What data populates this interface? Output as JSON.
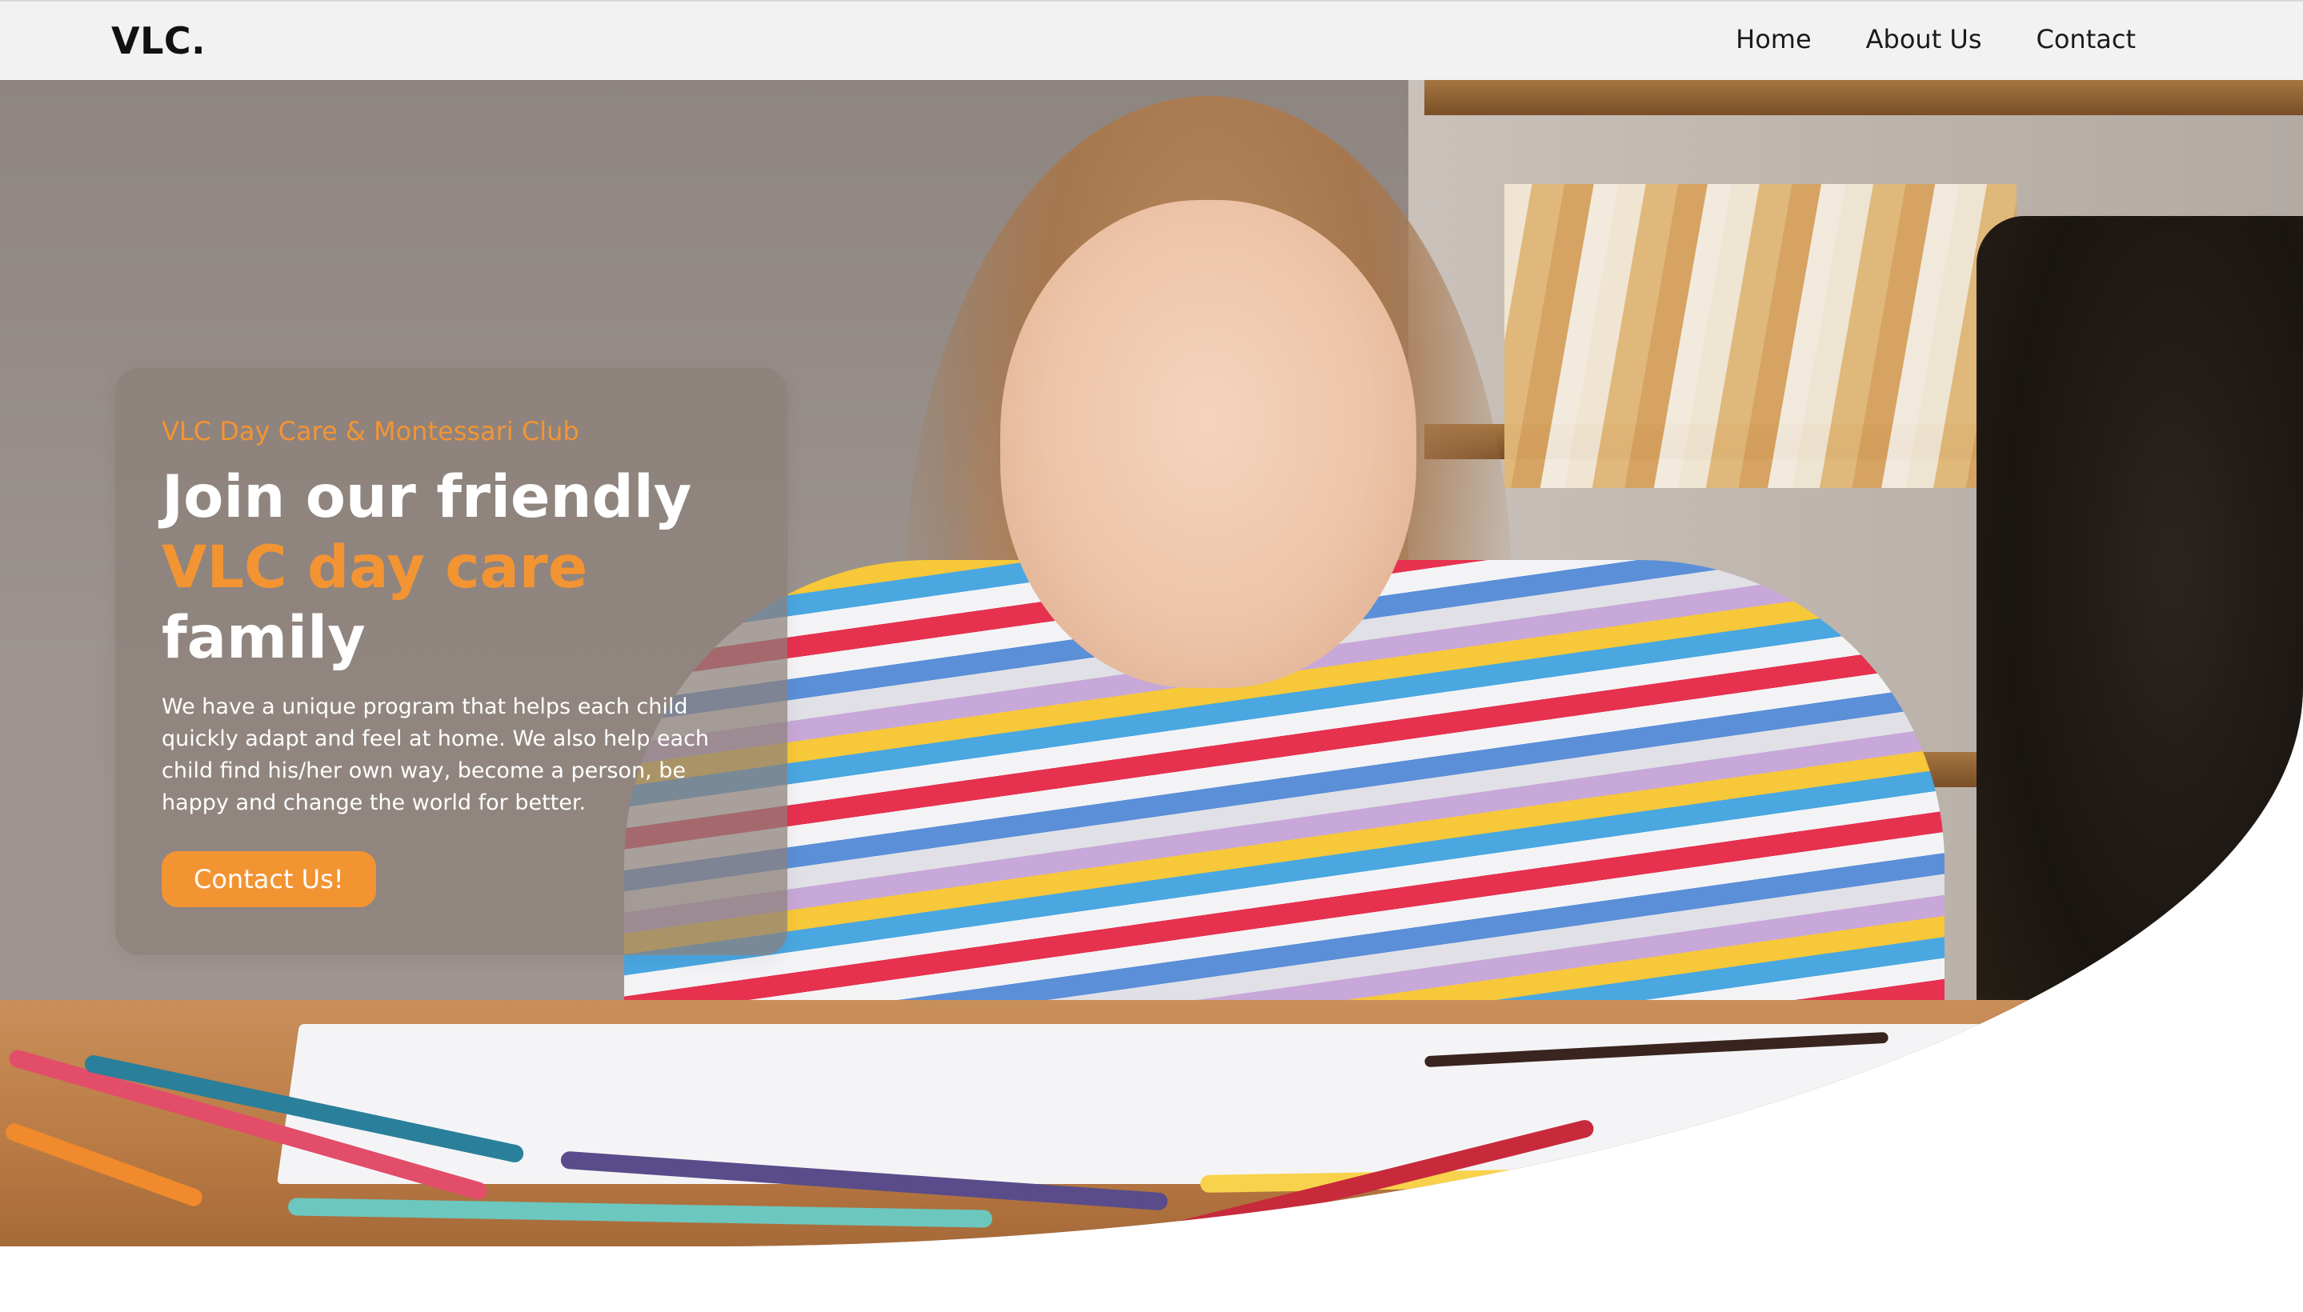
{
  "nav": {
    "logo": "VLC.",
    "links": [
      "Home",
      "About Us",
      "Contact"
    ]
  },
  "hero": {
    "eyebrow": "VLC Day Care & Montessari Club",
    "headline_line1": "Join our friendly",
    "headline_line2": "VLC day care",
    "headline_line3": "family",
    "description": "We have a unique program that helps each child quickly adapt and feel at home. We also help each child find his/her own way, become a person, be happy and change the world for better.",
    "cta_label": "Contact Us!",
    "image_subject": "girl drawing with colored pencils"
  },
  "colors": {
    "accent": "#f39433",
    "nav_background": "#f2f2f2",
    "card_background": "#8c8078"
  }
}
